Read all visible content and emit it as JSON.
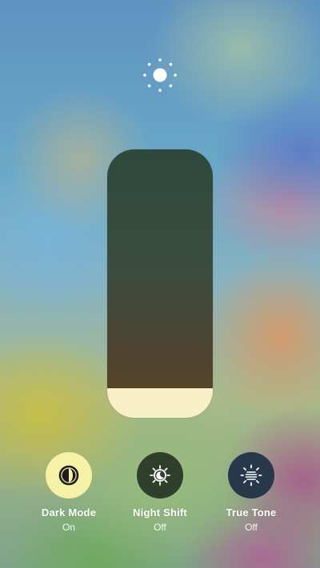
{
  "header": {
    "icon": "sun-brightness-icon"
  },
  "brightness": {
    "level": 0.11,
    "fill_color": "#f7f0c6"
  },
  "toggles": [
    {
      "label": "Dark Mode",
      "state": "On",
      "icon": "dark-mode-icon",
      "active": true,
      "bg": "#f5f1a6"
    },
    {
      "label": "Night Shift",
      "state": "Off",
      "icon": "night-shift-icon",
      "active": false,
      "bg": "#2f3f2b"
    },
    {
      "label": "True Tone",
      "state": "Off",
      "icon": "true-tone-icon",
      "active": false,
      "bg": "#27384a"
    }
  ]
}
